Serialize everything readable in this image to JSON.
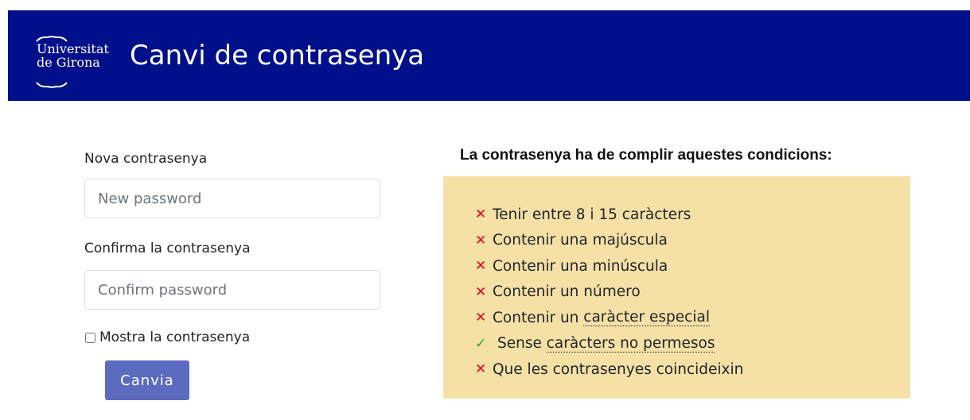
{
  "header": {
    "logo_line1": "Universitat",
    "logo_line2": "de Girona",
    "title": "Canvi de contrasenya",
    "background": "#000f8a"
  },
  "form": {
    "new_label": "Nova contrasenya",
    "new_placeholder": "New password",
    "confirm_label": "Confirma la contrasenya",
    "confirm_placeholder": "Confirm password",
    "show_label": "Mostra la contrasenya",
    "submit_label": "Canvia"
  },
  "conditions": {
    "heading": "La contrasenya ha de complir aquestes condicions:",
    "box_color": "#f5e0a6",
    "items": [
      {
        "status": "fail",
        "icon": "cross-icon",
        "text": "Tenir entre 8 i 15 caràcters"
      },
      {
        "status": "fail",
        "icon": "cross-icon",
        "text": "Contenir una majúscula"
      },
      {
        "status": "fail",
        "icon": "cross-icon",
        "text": "Contenir una minúscula"
      },
      {
        "status": "fail",
        "icon": "cross-icon",
        "text": "Contenir un número"
      },
      {
        "status": "fail",
        "icon": "cross-icon",
        "prefix": "Contenir un ",
        "abbr": "caràcter especial"
      },
      {
        "status": "ok",
        "icon": "check-icon",
        "prefix": "Sense ",
        "abbr": "caràcters no permesos"
      },
      {
        "status": "fail",
        "icon": "cross-icon",
        "text": "Que les contrasenyes coincideixin"
      }
    ]
  }
}
